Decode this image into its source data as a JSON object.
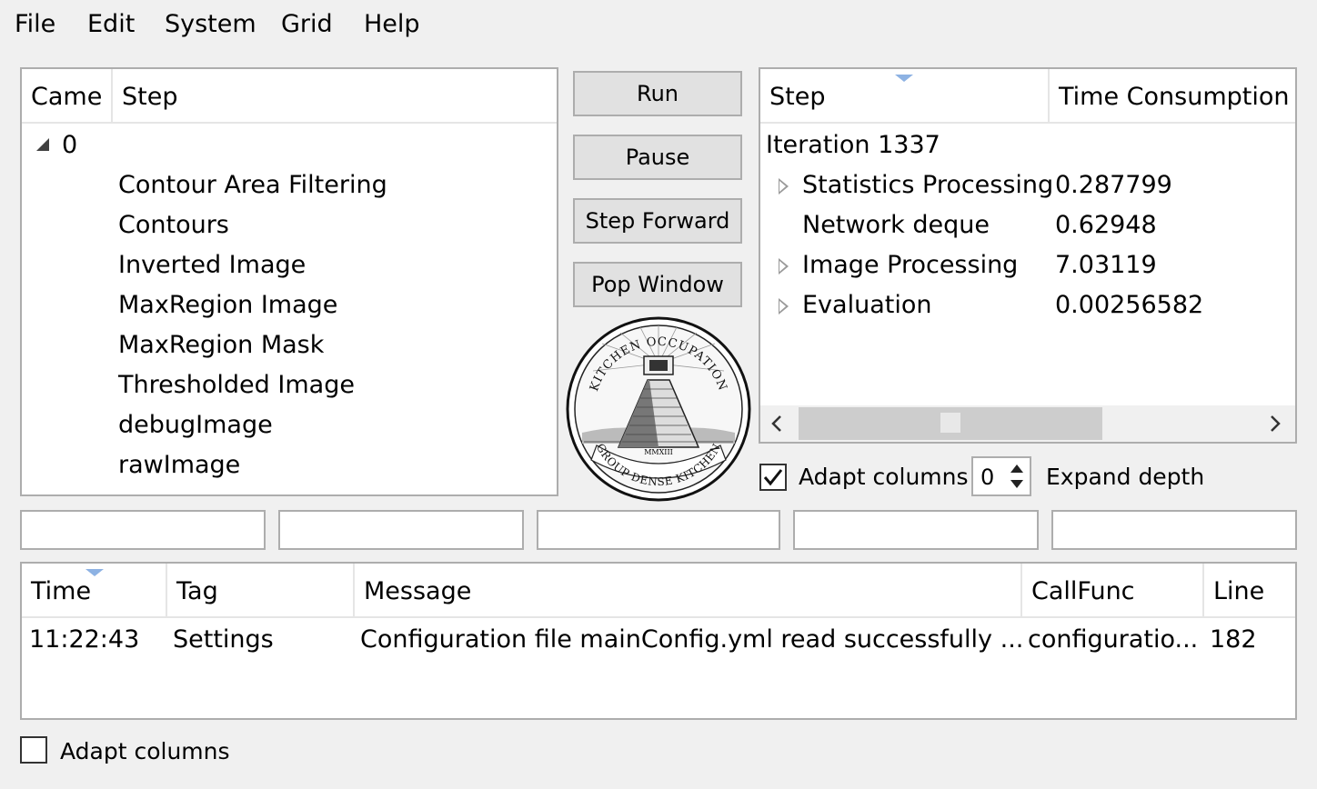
{
  "menu": [
    "File",
    "Edit",
    "System",
    "Grid",
    "Help"
  ],
  "steps_tree": {
    "headers": [
      "Came",
      "Step"
    ],
    "root": "0",
    "items": [
      "Contour Area Filtering",
      "Contours",
      "Inverted Image",
      "MaxRegion Image",
      "MaxRegion Mask",
      "Thresholded Image",
      "debugImage",
      "rawImage"
    ]
  },
  "controls": {
    "run": "Run",
    "pause": "Pause",
    "step_forward": "Step Forward",
    "pop_window": "Pop Window"
  },
  "emblem": {
    "top_text": "KITCHEN OCCUPATION",
    "bottom_text": "GROUP DENSE KITCHEN",
    "numeral": "MMXIII"
  },
  "timing": {
    "headers": [
      "Step",
      "Time Consumption"
    ],
    "iteration": "Iteration 1337",
    "rows": [
      {
        "name": "Statistics Processing",
        "value": "0.287799",
        "expandable": true
      },
      {
        "name": "Network deque",
        "value": "0.62948",
        "expandable": false
      },
      {
        "name": "Image Processing",
        "value": "7.03119",
        "expandable": true
      },
      {
        "name": "Evaluation",
        "value": "0.00256582",
        "expandable": true
      }
    ],
    "adapt_columns_label": "Adapt columns",
    "adapt_columns_checked": true,
    "expand_depth_value": "0",
    "expand_depth_label": "Expand depth"
  },
  "log": {
    "headers": [
      "Time",
      "Tag",
      "Message",
      "CallFunc",
      "Line"
    ],
    "rows": [
      {
        "time": "11:22:43",
        "tag": "Settings",
        "message": "Configuration file mainConfig.yml read successfully ...",
        "callfunc": "configuratio...",
        "line": "182"
      }
    ],
    "adapt_columns_label": "Adapt columns",
    "adapt_columns_checked": false
  },
  "colors": {
    "background": "#f0f0f0",
    "border": "#adadad",
    "button": "#e1e1e1",
    "sort_indicator": "#8db2e3"
  }
}
